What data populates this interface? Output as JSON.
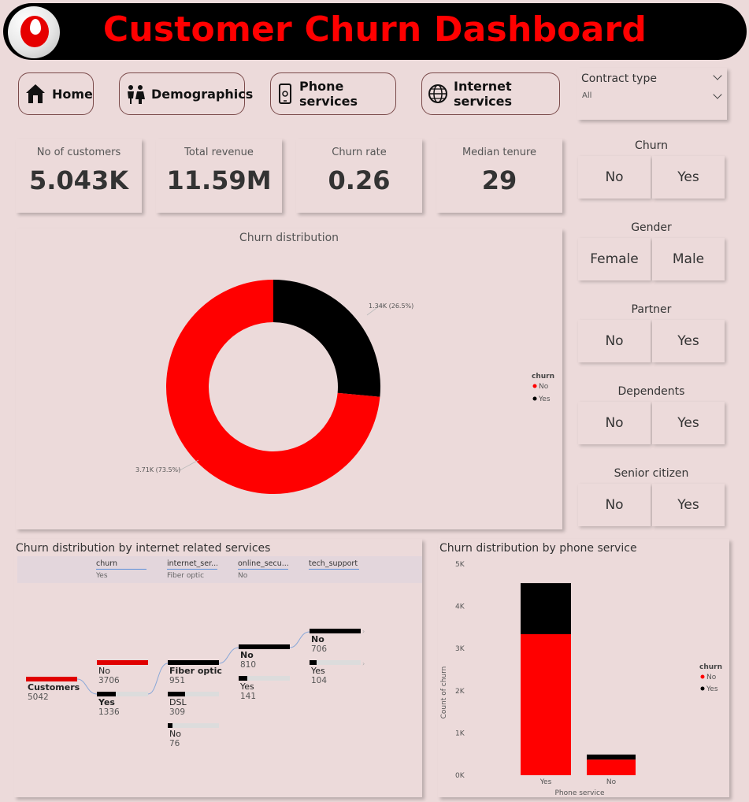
{
  "header": {
    "title": "Customer Churn Dashboard",
    "logo": "vodafone-logo"
  },
  "nav": [
    {
      "label": "Home",
      "icon": "home-icon"
    },
    {
      "label": "Demographics",
      "icon": "people-icon"
    },
    {
      "label": "Phone services",
      "icon": "phone-icon"
    },
    {
      "label": "Internet services",
      "icon": "globe-icon"
    }
  ],
  "contract": {
    "label": "Contract type",
    "value": "All"
  },
  "kpis": [
    {
      "label": "No of customers",
      "value": "5.043K"
    },
    {
      "label": "Total revenue",
      "value": "11.59M"
    },
    {
      "label": "Churn rate",
      "value": "0.26"
    },
    {
      "label": "Median tenure",
      "value": "29"
    }
  ],
  "slicers": [
    {
      "title": "Churn",
      "options": [
        "No",
        "Yes"
      ]
    },
    {
      "title": "Gender",
      "options": [
        "Female",
        "Male"
      ]
    },
    {
      "title": "Partner",
      "options": [
        "No",
        "Yes"
      ]
    },
    {
      "title": "Dependents",
      "options": [
        "No",
        "Yes"
      ]
    },
    {
      "title": "Senior citizen",
      "options": [
        "No",
        "Yes"
      ]
    }
  ],
  "colors": {
    "accent": "#ff0000",
    "no": "#ff0000",
    "yes": "#000000",
    "background": "#ecdada"
  },
  "donut": {
    "title": "Churn distribution",
    "legend_title": "churn",
    "legend": [
      "No",
      "Yes"
    ],
    "label_no": "3.71K (73.5%)",
    "label_yes": "1.34K (26.5%)"
  },
  "tree": {
    "title": "Churn distribution by internet related services",
    "columns": [
      {
        "name": "churn",
        "value": "Yes"
      },
      {
        "name": "internet_ser...",
        "value": "Fiber optic"
      },
      {
        "name": "online_secu...",
        "value": "No"
      },
      {
        "name": "tech_support",
        "value": ""
      }
    ],
    "root": {
      "label": "Customers",
      "value": "5042"
    },
    "level1": [
      {
        "label": "No",
        "value": "3706"
      },
      {
        "label": "Yes",
        "value": "1336"
      }
    ],
    "level2": [
      {
        "label": "Fiber optic",
        "value": "951"
      },
      {
        "label": "DSL",
        "value": "309"
      },
      {
        "label": "No",
        "value": "76"
      }
    ],
    "level3": [
      {
        "label": "No",
        "value": "810"
      },
      {
        "label": "Yes",
        "value": "141"
      }
    ],
    "level4": [
      {
        "label": "No",
        "value": "706"
      },
      {
        "label": "Yes",
        "value": "104"
      }
    ]
  },
  "phone_chart": {
    "title": "Churn distribution by phone service",
    "ylabel": "Count of churn",
    "xlabel": "Phone service",
    "legend_title": "churn",
    "legend": [
      "No",
      "Yes"
    ]
  },
  "chart_data": [
    {
      "type": "pie",
      "title": "Churn distribution",
      "categories": [
        "No",
        "Yes"
      ],
      "values": [
        3706,
        1336
      ],
      "legend_title": "churn"
    },
    {
      "type": "bar",
      "stacked": true,
      "title": "Churn distribution by phone service",
      "xlabel": "Phone service",
      "ylabel": "Count of churn",
      "categories": [
        "Yes",
        "No"
      ],
      "series": [
        {
          "name": "No",
          "values": [
            3340,
            370
          ]
        },
        {
          "name": "Yes",
          "values": [
            1210,
            120
          ]
        }
      ],
      "ylim": [
        0,
        5000
      ],
      "yticks": [
        "0K",
        "1K",
        "2K",
        "3K",
        "4K",
        "5K"
      ],
      "legend_title": "churn"
    }
  ]
}
